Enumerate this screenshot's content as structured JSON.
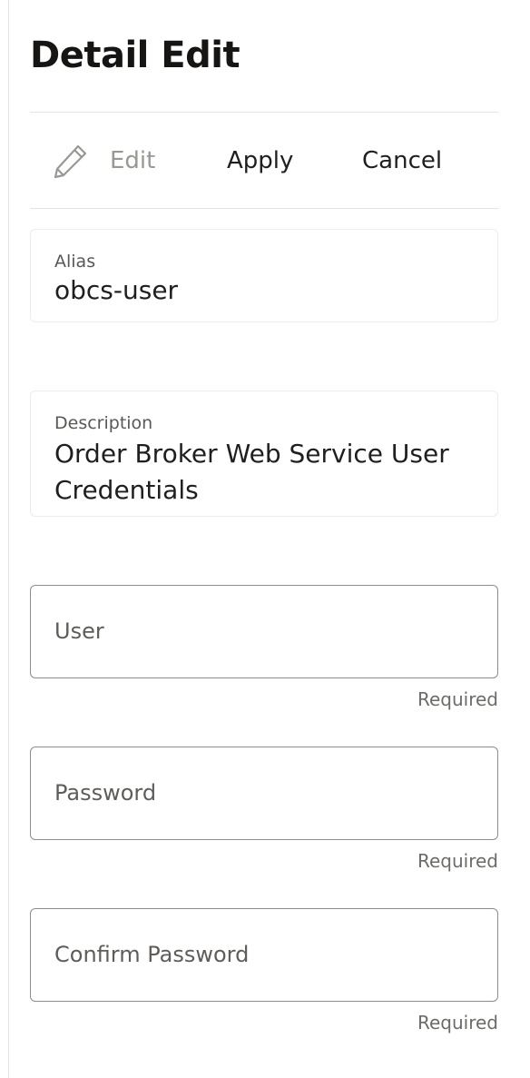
{
  "header": {
    "title": "Detail Edit"
  },
  "toolbar": {
    "edit_label": "Edit",
    "edit_icon": "pencil-icon",
    "apply_label": "Apply",
    "cancel_label": "Cancel"
  },
  "fields": {
    "alias": {
      "label": "Alias",
      "value": "obcs-user"
    },
    "description": {
      "label": "Description",
      "value": "Order Broker Web Service User Credentials"
    },
    "user": {
      "label": "User",
      "hint": "Required"
    },
    "password": {
      "label": "Password",
      "hint": "Required"
    },
    "confirm_password": {
      "label": "Confirm Password",
      "hint": "Required"
    }
  },
  "colors": {
    "title": "#161513",
    "disabled_text": "#9a9893",
    "input_border": "#8e8c89",
    "divider": "#e4e4e4"
  }
}
